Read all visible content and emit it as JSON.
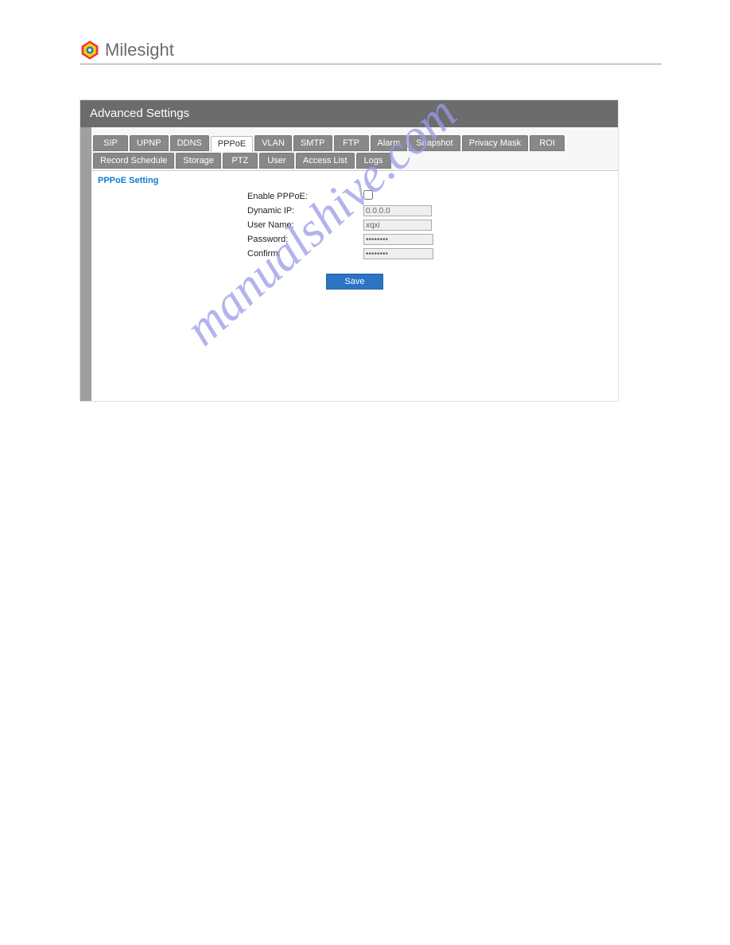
{
  "brand": {
    "name": "Milesight"
  },
  "panel": {
    "title": "Advanced Settings"
  },
  "tabs": {
    "row1": [
      "SIP",
      "UPNP",
      "DDNS",
      "PPPoE",
      "VLAN",
      "SMTP",
      "FTP",
      "Alarm",
      "Snapshot",
      "Privacy Mask",
      "ROI"
    ],
    "row2": [
      "Record Schedule",
      "Storage",
      "PTZ",
      "User",
      "Access List",
      "Logs"
    ],
    "active": "PPPoE"
  },
  "section": {
    "title": "PPPoE Setting"
  },
  "form": {
    "enable_label": "Enable PPPoE:",
    "enable_checked": false,
    "dynamic_ip_label": "Dynamic IP:",
    "dynamic_ip_value": "0.0.0.0",
    "user_name_label": "User Name:",
    "user_name_value": "xqxi",
    "password_label": "Password:",
    "password_value": "••••••••",
    "confirm_label": "Confirm:",
    "confirm_value": "••••••••"
  },
  "buttons": {
    "save": "Save"
  },
  "watermark": "manualshive.com"
}
